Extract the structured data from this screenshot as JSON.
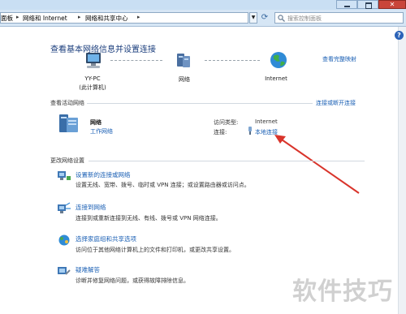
{
  "address": {
    "crumbs": [
      "面板",
      "网络和 Internet",
      "网络和共享中心"
    ],
    "search_placeholder": "搜索控制面板"
  },
  "window": {
    "close_glyph": "✕"
  },
  "main": {
    "title": "查看基本网络信息并设置连接",
    "see_full_map": "查看完整映射",
    "nodes": {
      "pc_name": "YY-PC",
      "pc_sub": "(此计算机)",
      "network": "网络",
      "internet": "Internet"
    },
    "active_header": "查看活动网络",
    "connect_disconnect": "连接或断开连接",
    "active_network": {
      "name": "网络",
      "type": "工作网络",
      "access_type_label": "访问类型:",
      "access_type_value": "Internet",
      "connection_label": "连接:",
      "connection_value": "本地连接"
    },
    "change_header": "更改网络设置",
    "tasks": [
      {
        "title": "设置新的连接或网络",
        "desc": "设置无线、宽带、拨号、临时或 VPN 连接；或设置路由器或访问点。"
      },
      {
        "title": "连接到网络",
        "desc": "连接到或重新连接到无线、有线、拨号或 VPN 网络连接。"
      },
      {
        "title": "选择家庭组和共享选项",
        "desc": "访问位于其他网络计算机上的文件和打印机，或更改共享设置。"
      },
      {
        "title": "疑难解答",
        "desc": "诊断并修复网络问题，或获得故障排除信息。"
      }
    ],
    "watermark": "软件技巧"
  },
  "colors": {
    "link": "#1a5fb4",
    "title": "#1a3d7c",
    "arrow": "#d9342b"
  }
}
